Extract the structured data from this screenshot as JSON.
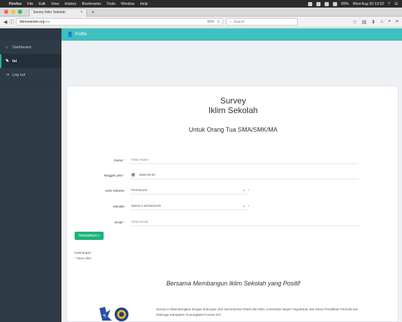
{
  "menubar": {
    "app": "Firefox",
    "items": [
      "File",
      "Edit",
      "View",
      "History",
      "Bookmarks",
      "Tools",
      "Window",
      "Help"
    ],
    "battery": "99%",
    "datetime": "Wed Aug 30 13:52"
  },
  "browser": {
    "tab_title": "Survey Iklim Sekolah",
    "url_host": "iklimsekolah.org",
    "url_path": "/sur",
    "zoom": "90%",
    "search_placeholder": "Search"
  },
  "sidebar": {
    "items": [
      {
        "label": "Dashboard",
        "icon": "home-icon"
      },
      {
        "label": "Isi",
        "icon": "edit-icon"
      },
      {
        "label": "Log out",
        "icon": "logout-icon"
      }
    ]
  },
  "topbar": {
    "label": "Profile"
  },
  "survey": {
    "title_line1": "Survey",
    "title_line2": "Iklim Sekolah",
    "subtitle": "Untuk Orang Tua SMA/SMK/MA",
    "fields": {
      "nama": {
        "label": "Nama",
        "placeholder": "Isikan Nama"
      },
      "tanggal": {
        "label": "Tanggal Lahir",
        "value": "0000-00-00"
      },
      "jenis_kelamin": {
        "label": "Jenis Kelamin",
        "value": "Perempuan"
      },
      "sekolah": {
        "label": "Sekolah",
        "value": "SMAN 2 WONOSARI"
      },
      "email": {
        "label": "Email",
        "placeholder": "Isikan Email"
      }
    },
    "next_button": "Selanjutnya »",
    "note_label": "Keterangan:",
    "note_required": "Harus diisi",
    "slogan": "Bersama Membangun Iklim Sekolah yang Positif",
    "description": "Survey ini dikembangkan dengan dukungan oleh Kementerian Ristek dan Dikti, Universitas Negeri Yogyakarta, dan Dinas Pendidikan Pemuda dan Olahraga Kabupaten Gunungkidul Provinsi DIY"
  }
}
